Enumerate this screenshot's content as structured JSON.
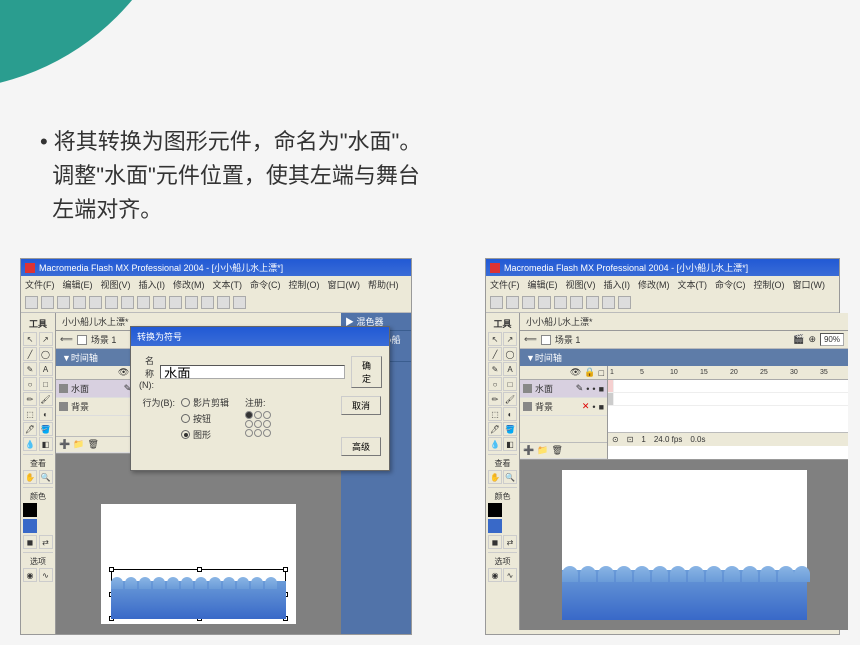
{
  "instruction": {
    "bullet": "•",
    "line1": "将其转换为图形元件，命名为\"水面\"。",
    "line2": "调整\"水面\"元件位置，使其左端与舞台",
    "line3": "左端对齐。"
  },
  "app": {
    "title": "Macromedia Flash MX Professional 2004 - [小小船儿水上漂*]",
    "menus": [
      "文件(F)",
      "编辑(E)",
      "视图(V)",
      "插入(I)",
      "修改(M)",
      "文本(T)",
      "命令(C)",
      "控制(O)",
      "窗口(W)",
      "帮助(H)"
    ]
  },
  "tools": {
    "title": "工具",
    "view": "查看",
    "colors": "颜色",
    "options": "选项"
  },
  "doc": {
    "tab": "小小船儿水上漂*",
    "scene": "场景 1",
    "timeline": "▼时间轴"
  },
  "layers": {
    "water": "水面",
    "bg": "背景"
  },
  "timeline_status": {
    "frame": "1",
    "fps": "24.0 fps",
    "time": "0.0s"
  },
  "panels": {
    "mixer": "▶ 混色器",
    "library": "▶ 库 - 小小船儿水上漂"
  },
  "dialog": {
    "title": "转换为符号",
    "name_label": "名称(N):",
    "name_value": "水面",
    "behavior_label": "行为(B):",
    "opt_movieclip": "影片剪辑",
    "opt_button": "按钮",
    "opt_graphic": "图形",
    "reg_label": "注册:",
    "btn_ok": "确定",
    "btn_cancel": "取消",
    "btn_advanced": "高级"
  },
  "right_view": {
    "zoom": "90%",
    "frame_marks": [
      "1",
      "5",
      "10",
      "15",
      "20",
      "25",
      "30",
      "35"
    ]
  }
}
